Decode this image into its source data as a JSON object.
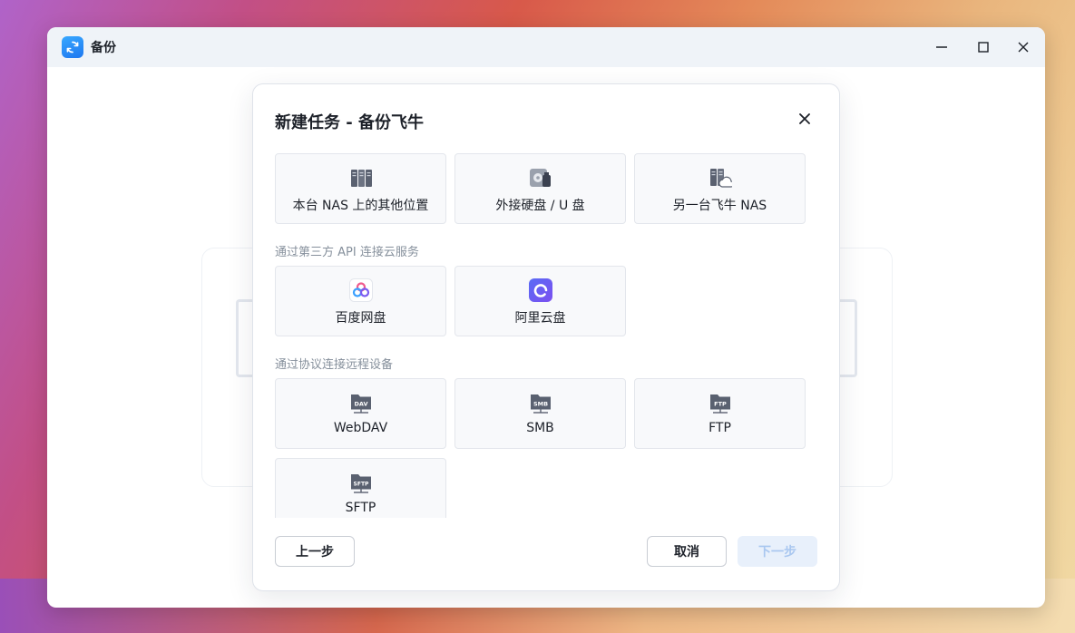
{
  "window": {
    "title": "备份",
    "app_icon": "backup-sync-icon",
    "controls": [
      "minimize-icon",
      "maximize-icon",
      "close-icon"
    ]
  },
  "dialog": {
    "title": "新建任务 - 备份飞牛",
    "close_icon": "close-icon",
    "local_options": [
      {
        "label": "本台 NAS 上的其他位置",
        "icon": "server-rack-icon"
      },
      {
        "label": "外接硬盘 / U 盘",
        "icon": "external-drive-icon"
      },
      {
        "label": "另一台飞牛 NAS",
        "icon": "server-cloud-icon"
      }
    ],
    "cloud_section_label": "通过第三方 API 连接云服务",
    "cloud_options": [
      {
        "label": "百度网盘",
        "icon": "baidu-netdisk-icon"
      },
      {
        "label": "阿里云盘",
        "icon": "aliyun-drive-icon"
      }
    ],
    "protocol_section_label": "通过协议连接远程设备",
    "protocol_options": [
      {
        "label": "WebDAV",
        "icon_text": "DAV",
        "icon": "webdav-folder-icon"
      },
      {
        "label": "SMB",
        "icon_text": "SMB",
        "icon": "smb-folder-icon"
      },
      {
        "label": "FTP",
        "icon_text": "FTP",
        "icon": "ftp-folder-icon"
      },
      {
        "label": "SFTP",
        "icon_text": "SFTP",
        "icon": "sftp-folder-icon"
      }
    ],
    "buttons": {
      "prev": "上一步",
      "cancel": "取消",
      "next": "下一步"
    }
  },
  "colors": {
    "accent": "#1e77f0",
    "next_disabled_bg": "#e8f0fb",
    "next_disabled_text": "#a9c7f0"
  }
}
